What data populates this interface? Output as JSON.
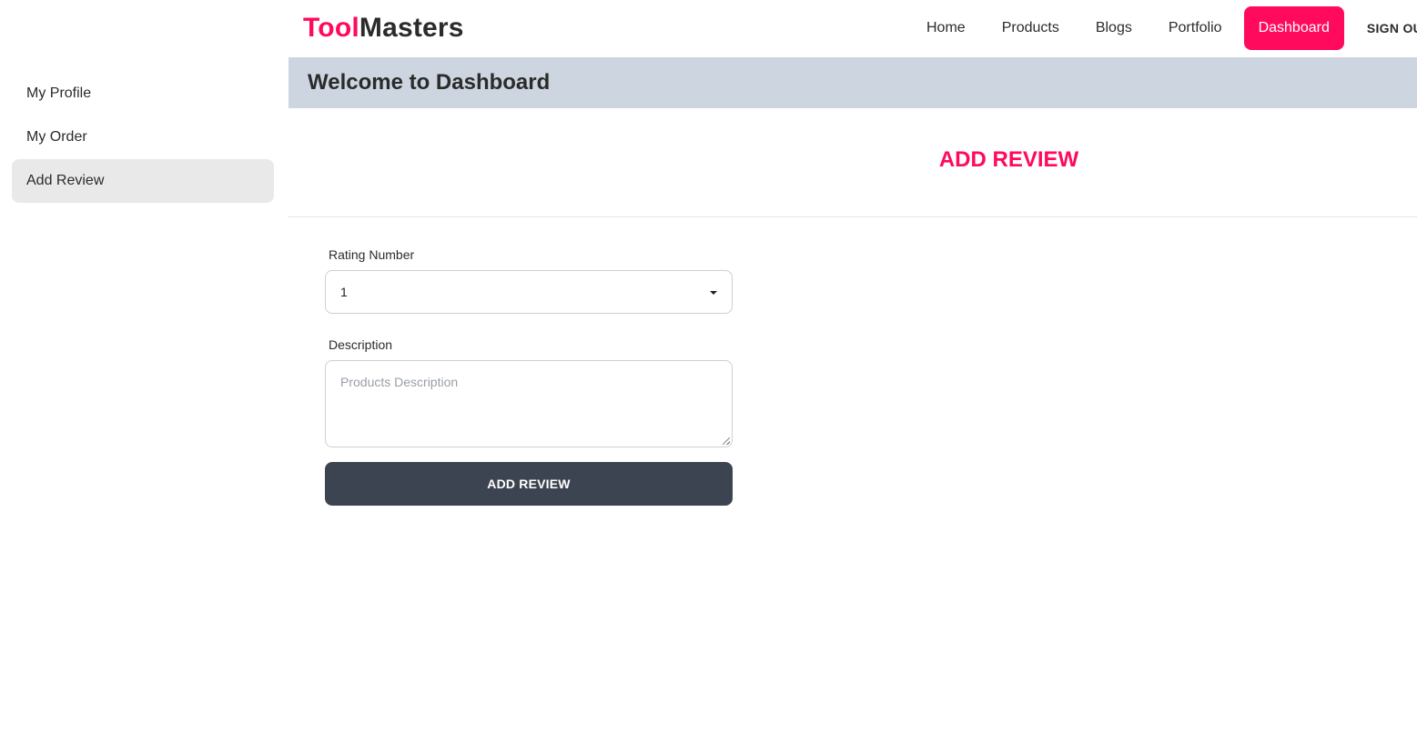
{
  "colors": {
    "brand": "#ff0a5c",
    "button": "#3d4451",
    "welcome_bg": "#cdd5e1"
  },
  "brand": {
    "part1": "Tool",
    "part2": "Masters"
  },
  "nav": {
    "items": [
      "Home",
      "Products",
      "Blogs",
      "Portfolio",
      "Dashboard"
    ],
    "active": "Dashboard",
    "signout": "SIGN OUT"
  },
  "sidebar": {
    "items": [
      "My Profile",
      "My Order",
      "Add Review"
    ],
    "active": "Add Review"
  },
  "welcome": {
    "title": "Welcome to Dashboard"
  },
  "review": {
    "heading": "ADD REVIEW",
    "rating_label": "Rating Number",
    "rating_value": "1",
    "description_label": "Description",
    "description_placeholder": "Products Description",
    "submit_label": "ADD REVIEW"
  }
}
